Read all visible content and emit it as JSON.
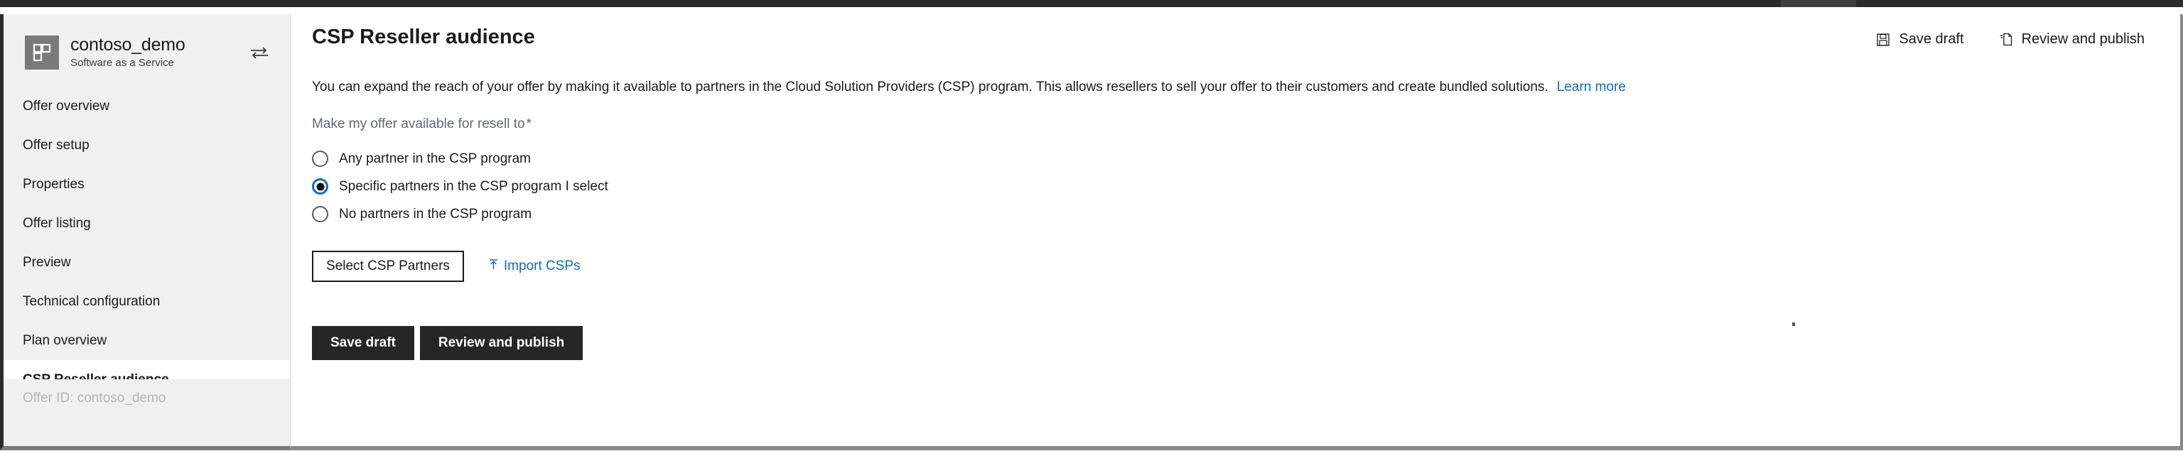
{
  "window": {
    "topbar_color": "#2b2b2b"
  },
  "sidebar": {
    "brand": {
      "icon": "app-grid-icon",
      "title": "contoso_demo",
      "subtitle": "Software as a Service",
      "swap_icon": "swap-horizontal-icon"
    },
    "items": [
      {
        "label": "Offer overview",
        "selected": false
      },
      {
        "label": "Offer setup",
        "selected": false
      },
      {
        "label": "Properties",
        "selected": false
      },
      {
        "label": "Offer listing",
        "selected": false
      },
      {
        "label": "Preview",
        "selected": false
      },
      {
        "label": "Technical configuration",
        "selected": false
      },
      {
        "label": "Plan overview",
        "selected": false
      },
      {
        "label": "CSP Reseller audience",
        "selected": true
      }
    ],
    "footer": "Offer ID: contoso_demo"
  },
  "header": {
    "title": "CSP Reseller audience",
    "actions": [
      {
        "label": "Save draft",
        "icon": "save-disk-icon"
      },
      {
        "label": "Review and publish",
        "icon": "publish-document-icon"
      }
    ]
  },
  "main": {
    "intro_text": "You can expand the reach of your offer by making it available to partners in the Cloud Solution Providers (CSP) program. This allows resellers to sell your offer to their customers and create bundled solutions.",
    "learn_more_label": "Learn more",
    "field_label": "Make my offer available for resell to",
    "required_marker": "*",
    "radio_options": [
      {
        "label": "Any partner in the CSP program",
        "checked": false
      },
      {
        "label": "Specific partners in the CSP program I select",
        "checked": true
      },
      {
        "label": "No partners in the CSP program",
        "checked": false
      }
    ],
    "select_partners_label": "Select CSP Partners",
    "import_csps_label": "Import CSPs",
    "import_icon": "upload-arrow-icon",
    "buttons": [
      {
        "label": "Save draft"
      },
      {
        "label": "Review and publish"
      }
    ]
  },
  "colors": {
    "accent": "#0f6cbd",
    "link": "#0f6cbd",
    "primary_button": "#262626",
    "sidebar_bg": "#f0f0f0",
    "radio_selected_ring": "#0f6cbd"
  }
}
